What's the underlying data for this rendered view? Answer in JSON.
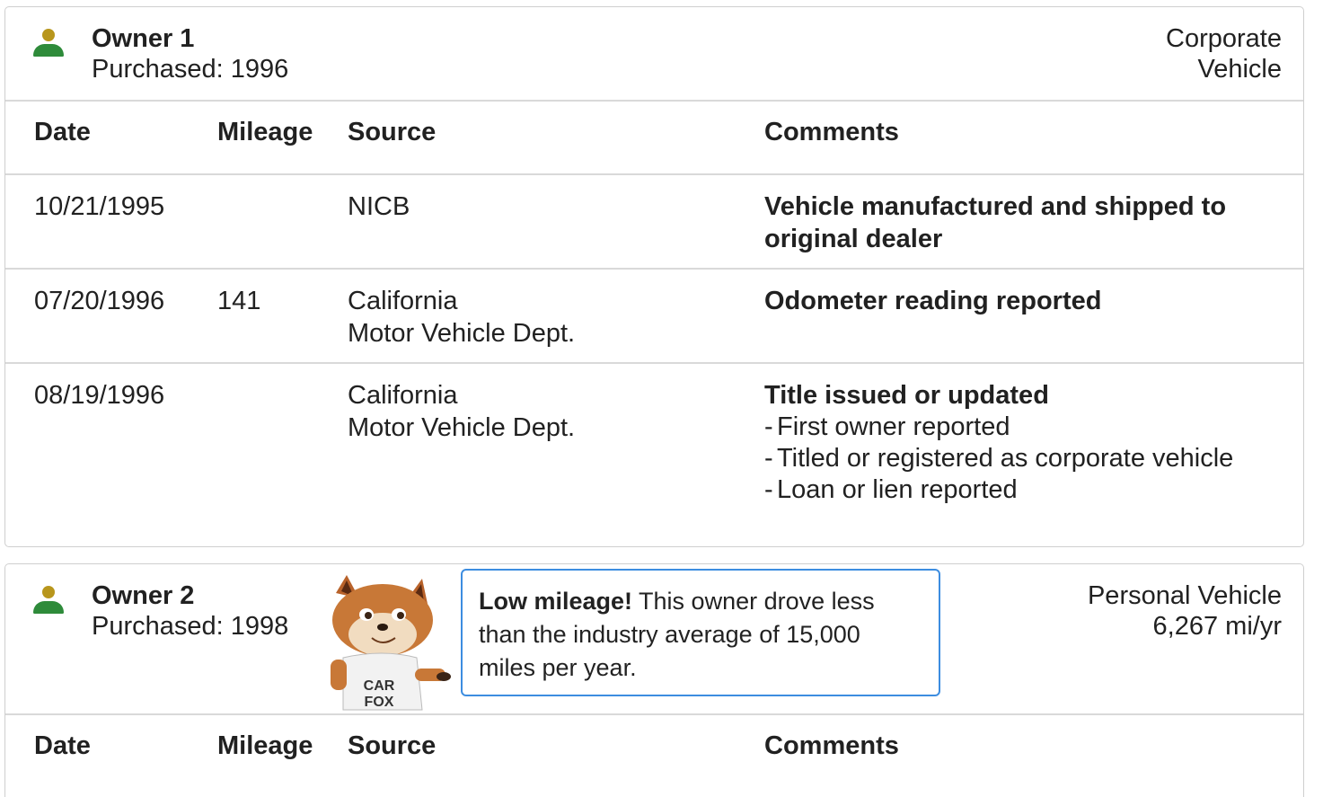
{
  "owner1": {
    "title": "Owner 1",
    "purchased": "Purchased: 1996",
    "right_lines": [
      "Corporate",
      "Vehicle"
    ],
    "table": {
      "headers": {
        "date": "Date",
        "mileage": "Mileage",
        "source": "Source",
        "comments": "Comments"
      },
      "rows": [
        {
          "date": "10/21/1995",
          "mileage": "",
          "source": [
            "NICB"
          ],
          "comment_title": "Vehicle manufactured and shipped to original dealer",
          "comment_items": []
        },
        {
          "date": "07/20/1996",
          "mileage": "141",
          "source": [
            "California",
            "Motor Vehicle Dept."
          ],
          "comment_title": "Odometer reading reported",
          "comment_items": []
        },
        {
          "date": "08/19/1996",
          "mileage": "",
          "source": [
            "California",
            "Motor Vehicle Dept."
          ],
          "comment_title": "Title issued or updated",
          "comment_items": [
            "First owner reported",
            "Titled or registered as corporate vehicle",
            "Loan or lien reported"
          ]
        }
      ]
    }
  },
  "owner2": {
    "title": "Owner 2",
    "purchased": "Purchased: 1998",
    "right_lines": [
      "Personal Vehicle",
      "6,267 mi/yr"
    ],
    "callout": {
      "bold": "Low mileage!",
      "text": " This owner drove less than the industry average of 15,000 miles per year."
    },
    "mascot_text": [
      "CAR",
      "FOX"
    ],
    "table": {
      "headers": {
        "date": "Date",
        "mileage": "Mileage",
        "source": "Source",
        "comments": "Comments"
      }
    }
  },
  "colors": {
    "icon_head": "#b8961c",
    "icon_body": "#2e8b3a",
    "callout_border": "#3d8de0"
  }
}
